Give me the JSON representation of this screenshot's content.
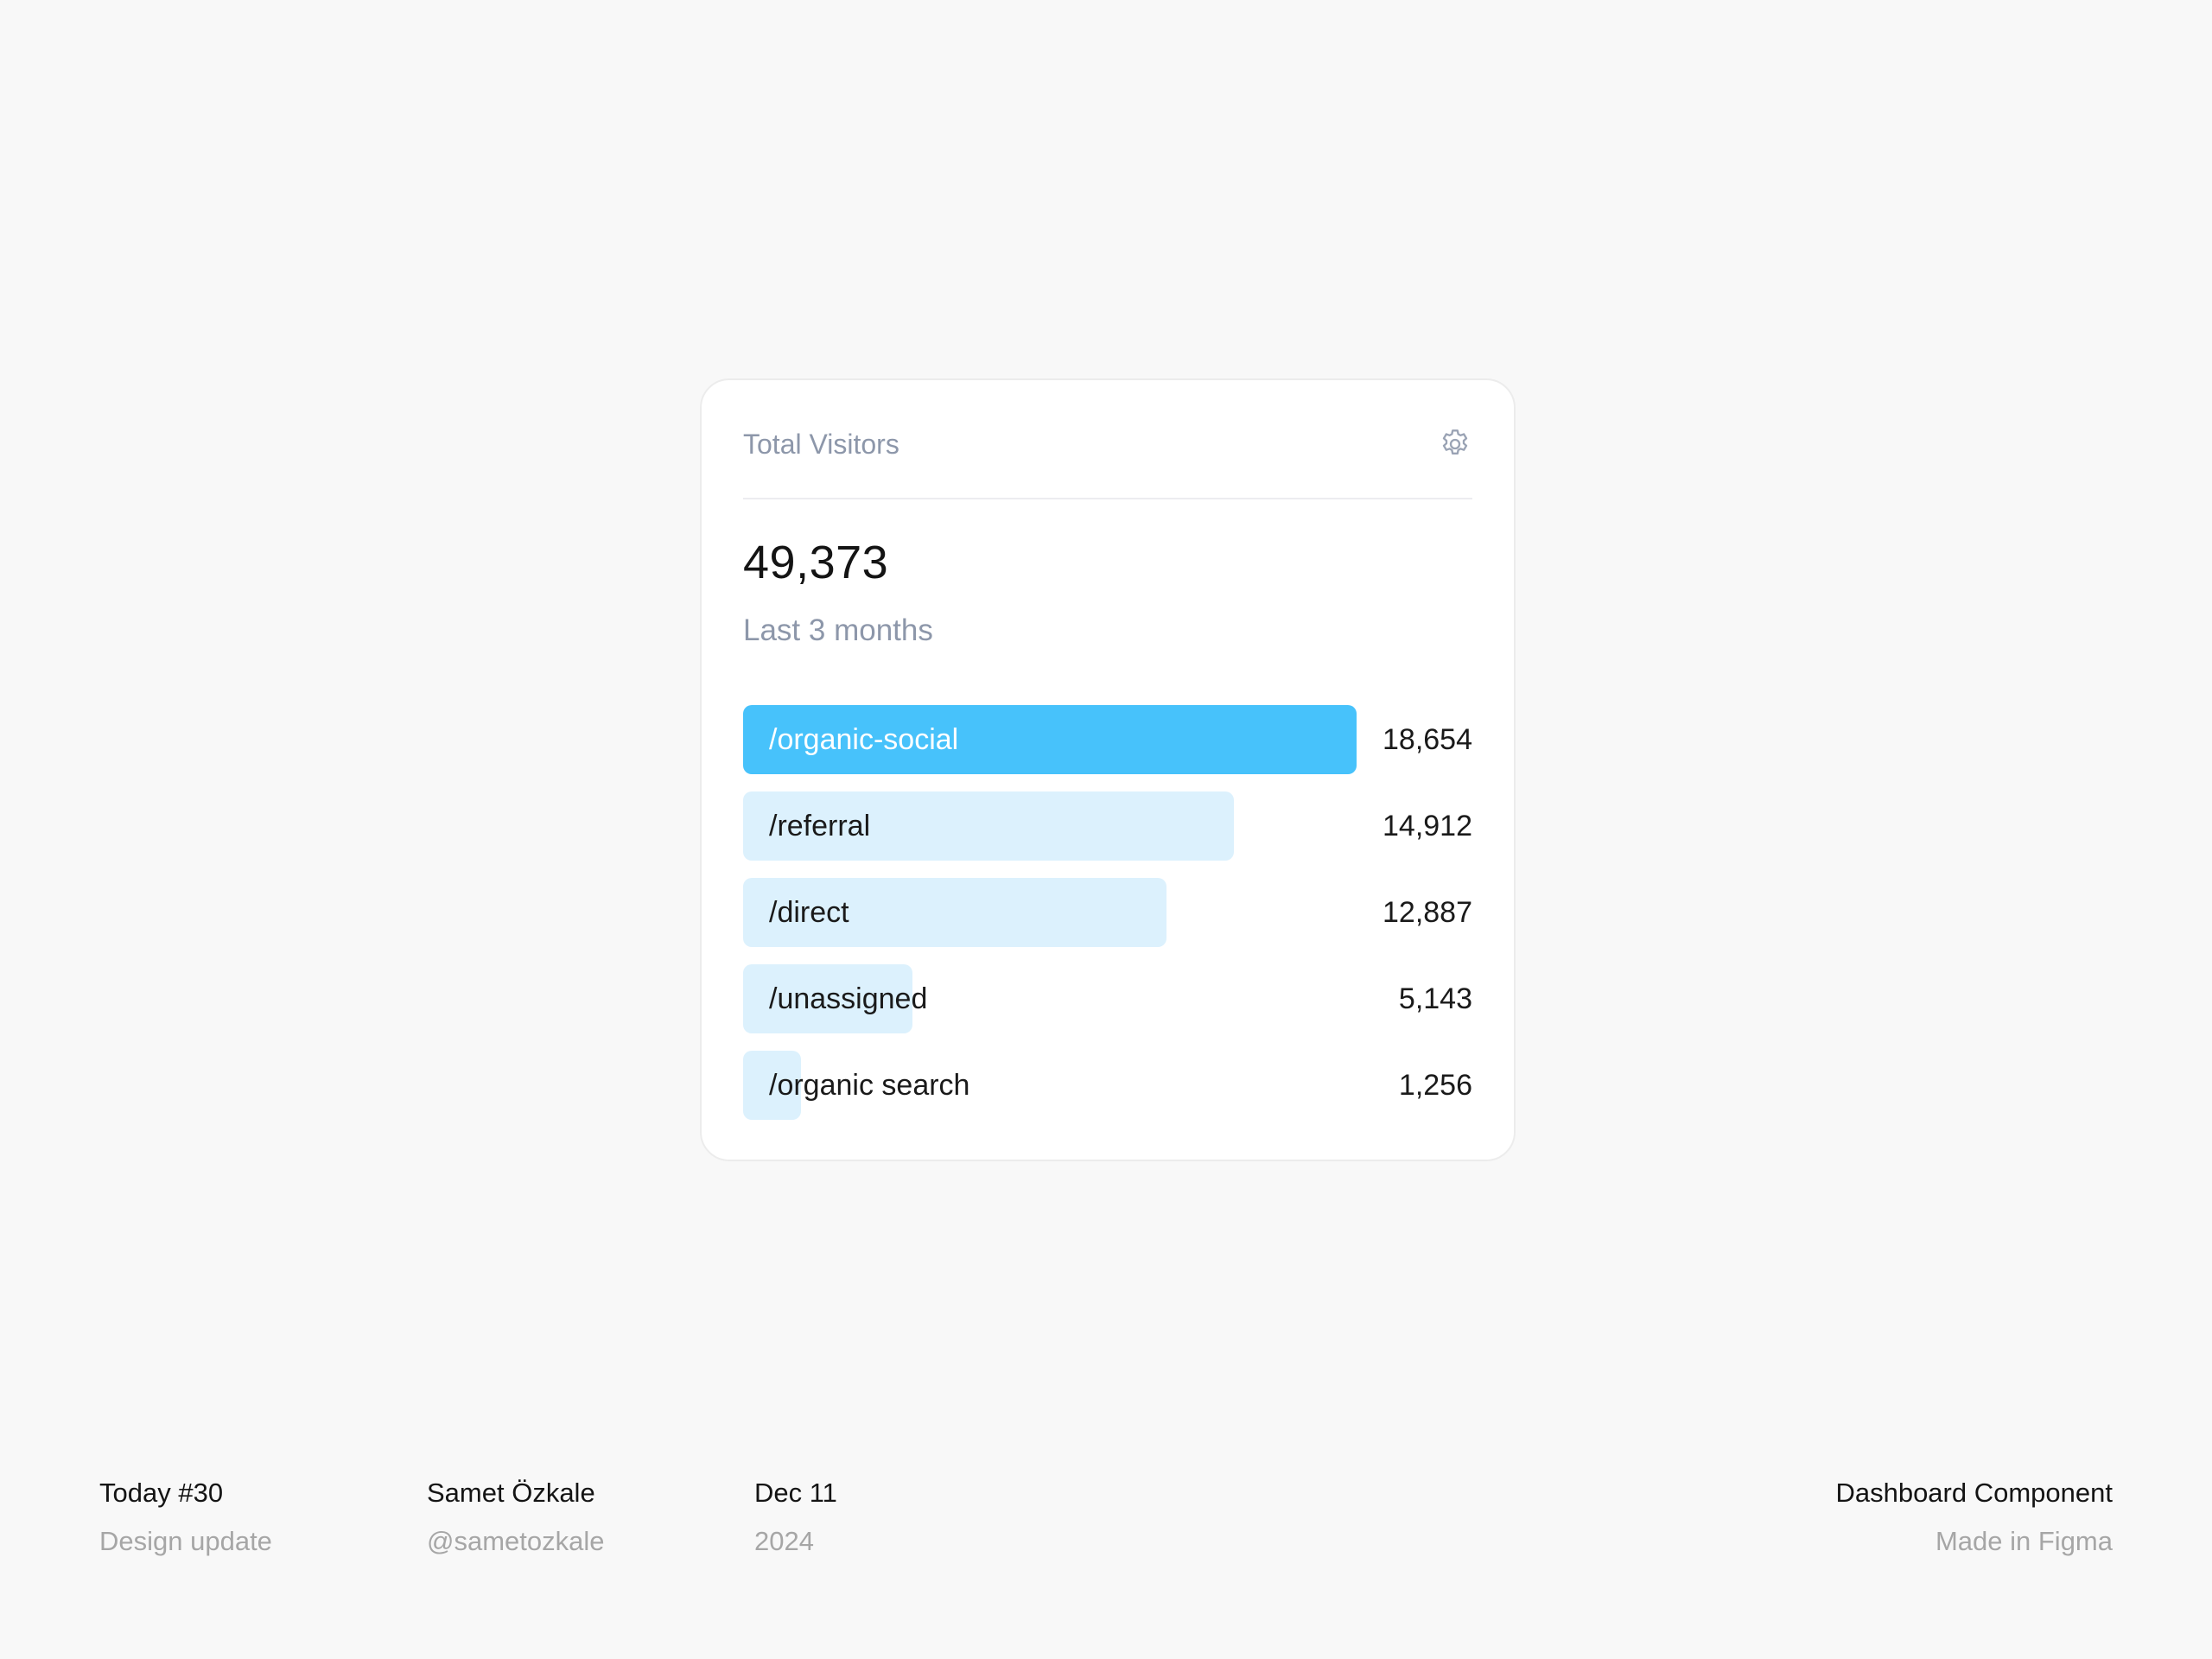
{
  "card": {
    "title": "Total Visitors",
    "total": "49,373",
    "period": "Last 3 months",
    "settings_icon": "gear-icon",
    "accent_color": "#47c2fb",
    "bar_color": "#dcf1fd"
  },
  "sources": [
    {
      "label": "/organic-social",
      "value": "18,654",
      "count": 18654
    },
    {
      "label": "/referral",
      "value": "14,912",
      "count": 14912
    },
    {
      "label": "/direct",
      "value": "12,887",
      "count": 12887
    },
    {
      "label": "/unassigned",
      "value": "5,143",
      "count": 5143
    },
    {
      "label": "/organic search",
      "value": "1,256",
      "count": 1256
    }
  ],
  "footer": {
    "col1": {
      "line1": "Today #30",
      "line2": "Design update"
    },
    "col2": {
      "line1": "Samet Özkale",
      "line2": "@sametozkale"
    },
    "col3": {
      "line1": "Dec 11",
      "line2": "2024"
    },
    "col4": {
      "line1": "Dashboard Component",
      "line2": "Made in Figma"
    }
  }
}
